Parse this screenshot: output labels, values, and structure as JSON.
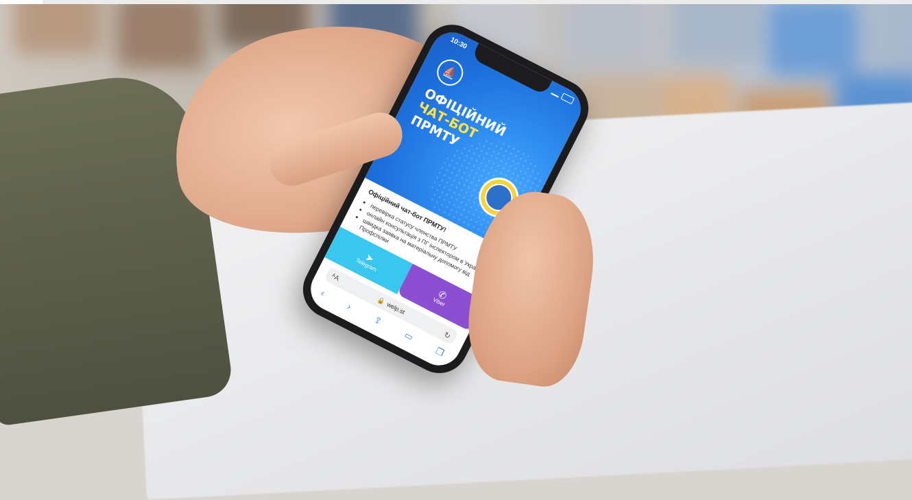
{
  "status_bar": {
    "time": "10:30"
  },
  "banner": {
    "headline_line1": "ОФІЦІЙНИЙ",
    "headline_line2": "ЧАТ-БОТ",
    "headline_line3": "ПРМТУ"
  },
  "card": {
    "title": "Офіційний чат-бот ПРМТУ!",
    "bullets": [
      "перевірка статусу членства ПРМТУ",
      "онлайн консультація з ПГ інспектором в Україні",
      "швидка заявка на матеріальну допомогу від Профспілки"
    ]
  },
  "buttons": {
    "telegram_label": "Telegram",
    "viber_label": "Viber"
  },
  "browser": {
    "url": "welp.st"
  },
  "colors": {
    "banner_blue": "#1d6fdb",
    "accent_yellow": "#ffe24a",
    "telegram_blue": "#39c7ef",
    "viber_purple": "#8d4fd1"
  }
}
